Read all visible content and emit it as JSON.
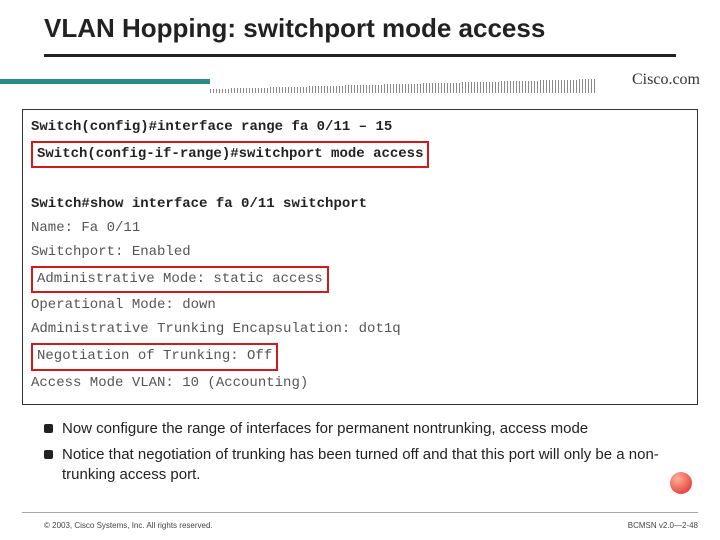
{
  "title": "VLAN Hopping: switchport mode access",
  "brand": "Cisco.com",
  "terminal": {
    "l1_prompt": "Switch(config)#",
    "l1_cmd": "interface range fa 0/11 – 15",
    "l2_prompt": "Switch(config-if-range)#",
    "l2_cmd": "switchport mode access",
    "l3_prompt": "Switch#",
    "l3_cmd": "show interface fa 0/11 switchport",
    "l4": "Name: Fa 0/11",
    "l5": "Switchport: Enabled",
    "l6": "Administrative Mode: static access",
    "l7": "Operational Mode: down",
    "l8": "Administrative Trunking Encapsulation: dot1q",
    "l9": "Negotiation of Trunking: Off",
    "l10": "Access Mode VLAN: 10 (Accounting)"
  },
  "bullets": [
    "Now configure the range of interfaces for permanent nontrunking, access mode",
    "Notice that negotiation of trunking has been turned off and that this port will only be a non-trunking access port."
  ],
  "footer": {
    "copyright": "© 2003, Cisco Systems, Inc. All rights reserved.",
    "pagecode": "BCMSN v2.0—2-48"
  }
}
